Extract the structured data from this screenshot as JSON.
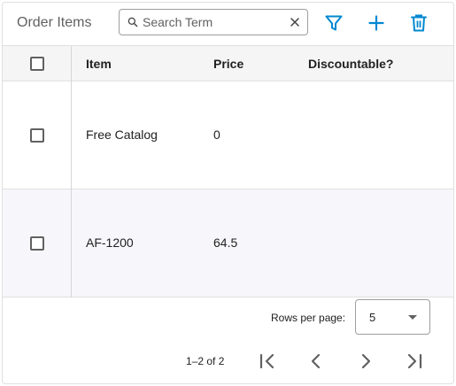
{
  "toolbar": {
    "title": "Order Items",
    "search": {
      "placeholder": "Search Term",
      "value": ""
    },
    "icons": [
      "search-icon",
      "clear-icon",
      "filter-icon",
      "add-icon",
      "delete-icon"
    ]
  },
  "table": {
    "columns": [
      "Item",
      "Price",
      "Discountable?"
    ],
    "rows": [
      {
        "item": "Free Catalog",
        "price": "0",
        "discountable": ""
      },
      {
        "item": "AF-1200",
        "price": "64.5",
        "discountable": ""
      }
    ]
  },
  "pagination": {
    "rows_per_page_label": "Rows per page:",
    "rows_per_page_value": "5",
    "range": "1–2 of 2",
    "icons": [
      "first-page-icon",
      "previous-page-icon",
      "next-page-icon",
      "last-page-icon"
    ]
  },
  "colors": {
    "accent": "#0288d1",
    "header_bg": "#f5f5f5",
    "row_alt_bg": "#f7f7fb",
    "border": "#e0e0e0"
  }
}
